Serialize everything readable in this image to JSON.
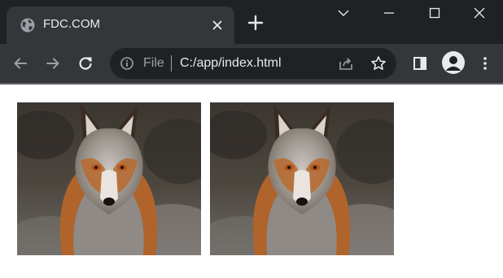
{
  "browser": {
    "tab": {
      "title": "FDC.COM",
      "favicon": "globe-icon",
      "close_icon": "close-icon"
    },
    "new_tab_icon": "plus-icon",
    "window_controls": [
      "chevron-down-icon",
      "minimize-icon",
      "maximize-icon",
      "close-icon"
    ],
    "toolbar": {
      "back_icon": "arrow-left-icon",
      "forward_icon": "arrow-right-icon",
      "reload_icon": "reload-icon",
      "omnibox": {
        "info_icon": "info-icon",
        "scheme": "File",
        "url": "C:/app/index.html",
        "share_icon": "share-icon",
        "bookmark_icon": "star-icon"
      },
      "side_panel_icon": "side-panel-icon",
      "profile_icon": "avatar-icon",
      "menu_icon": "kebab-menu-icon"
    },
    "colors": {
      "tabstrip": "#202124",
      "active_tab": "#35363a",
      "toolbar": "#35363a",
      "omnibox": "#202124",
      "text_primary": "#e8eaed",
      "text_secondary": "#9aa0a6",
      "page_background": "#ffffff"
    }
  },
  "page": {
    "images": [
      {
        "subject": "fox-photo"
      },
      {
        "subject": "fox-photo"
      }
    ]
  }
}
